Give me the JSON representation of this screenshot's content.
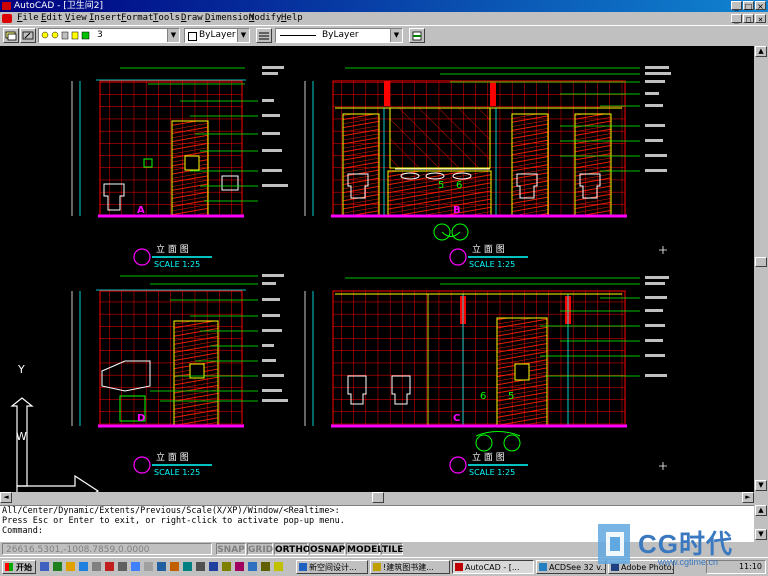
{
  "window": {
    "title": "AutoCAD - [卫生间2]",
    "controls": [
      "_",
      "□",
      "×"
    ],
    "doc_controls": [
      "_",
      "□",
      "×"
    ]
  },
  "menu": [
    "File",
    "Edit",
    "View",
    "Insert",
    "Format",
    "Tools",
    "Draw",
    "Dimension",
    "Modify",
    "Help"
  ],
  "toolbar": {
    "layer_value": "3",
    "color_value": "ByLayer",
    "linetype_value": "ByLayer"
  },
  "drawing": {
    "views": [
      {
        "letter": "A",
        "title": "立 面 图",
        "scale": "SCALE 1:25"
      },
      {
        "letter": "B",
        "title": "立 面 图",
        "scale": "SCALE 1:25"
      },
      {
        "letter": "D",
        "title": "立 面 图",
        "scale": "SCALE 1:25"
      },
      {
        "letter": "C",
        "title": "立 面 图",
        "scale": "SCALE 1:25"
      }
    ],
    "section_marks": [
      {
        "left": "5",
        "right": "6"
      },
      {
        "left": "6",
        "right": "5"
      }
    ],
    "ucs": {
      "y": "Y",
      "w": "W"
    },
    "colors": {
      "background": "#000000",
      "tile_grid": "#ff0000",
      "floor": "#ff00ff",
      "annotation": "#00ff00",
      "walls": "#ffff00",
      "dims": "#00ffff"
    }
  },
  "command": {
    "line1": "All/Center/Dynamic/Extents/Previous/Scale(X/XP)/Window/<Realtime>:",
    "line2": "Press Esc or Enter to exit, or right-click to activate pop-up menu.",
    "prompt": "Command:"
  },
  "status": {
    "coords": "26616.5301,-1008.7859,0.0000",
    "toggles": [
      "SNAP",
      "GRID",
      "ORTHO",
      "OSNAP",
      "MODEL",
      "TILE"
    ],
    "on": [
      false,
      false,
      true,
      true,
      true,
      true
    ]
  },
  "taskbar": {
    "start": "开始",
    "tasks": [
      "新空间设计...",
      "!建筑图书建...",
      "AutoCAD - [...",
      "ACDSee 32 v...",
      "Adobe Photo..."
    ],
    "clock": "11:10"
  },
  "watermark": {
    "brand": "CG时代",
    "url": "www.cgtime.cn"
  }
}
